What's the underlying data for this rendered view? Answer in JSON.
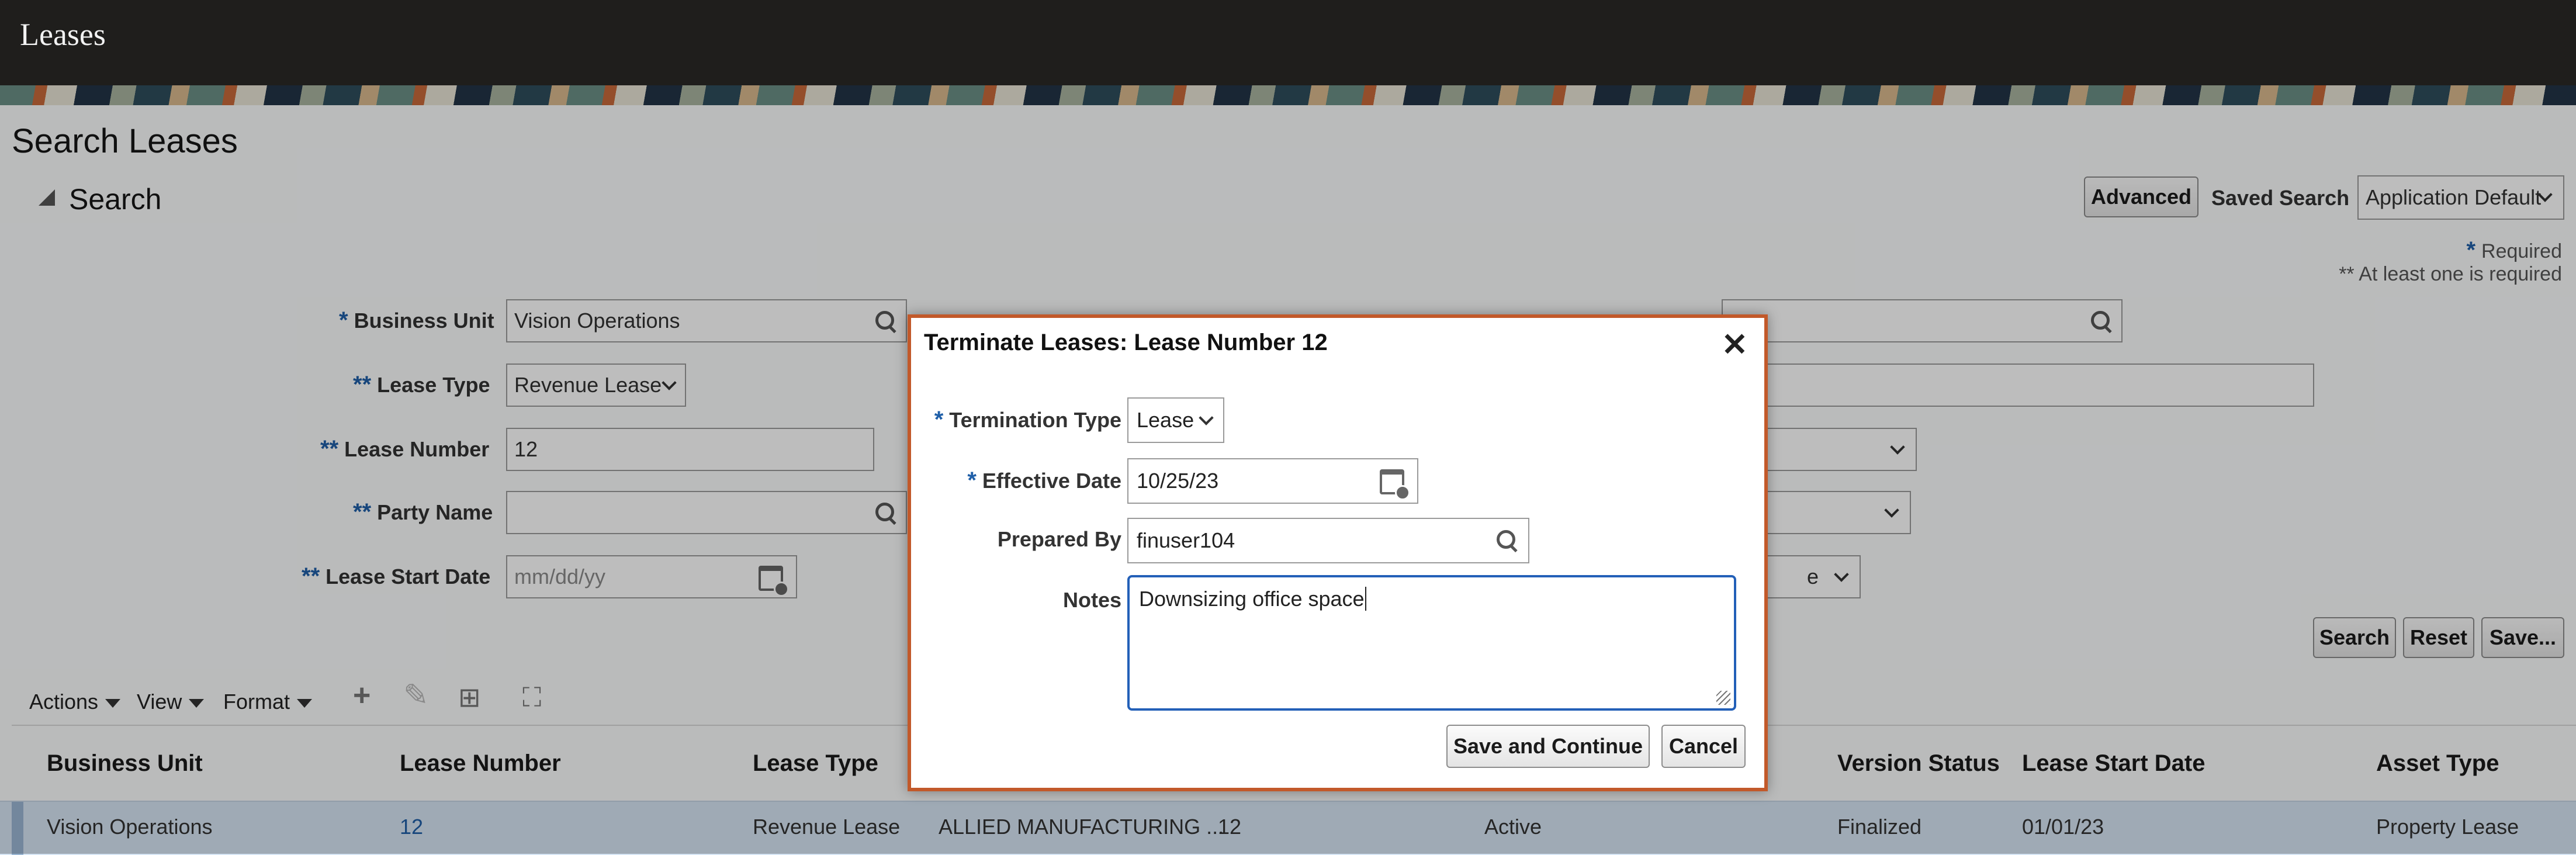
{
  "app": {
    "title": "Leases"
  },
  "page": {
    "title": "Search Leases"
  },
  "search": {
    "header": "Search",
    "advanced_label": "Advanced",
    "saved_search_label": "Saved Search",
    "saved_search_value": "Application Default",
    "required_note": "Required",
    "required_star": "*",
    "at_least_one_note": "** At least one is required",
    "fields": {
      "business_unit": {
        "label": "Business Unit",
        "marker": "*",
        "value": "Vision Operations"
      },
      "lease_type": {
        "label": "Lease Type",
        "marker": "**",
        "value": "Revenue Lease"
      },
      "lease_number": {
        "label": "Lease Number",
        "marker": "**",
        "value": "12"
      },
      "party_name": {
        "label": "Party Name",
        "marker": "**",
        "value": ""
      },
      "lease_start_date": {
        "label": "Lease Start Date",
        "marker": "**",
        "placeholder": "mm/dd/yy"
      }
    },
    "right_fields": {
      "partial_select_text": "e"
    },
    "buttons": {
      "search": "Search",
      "reset": "Reset",
      "save": "Save..."
    }
  },
  "toolbar": {
    "actions": "Actions",
    "view": "View",
    "format": "Format"
  },
  "table": {
    "columns": [
      "Business Unit",
      "Lease Number",
      "Lease Type",
      "Version Status",
      "Lease Start Date",
      "Asset Type"
    ],
    "rows": [
      {
        "business_unit": "Vision Operations",
        "lease_number": "12",
        "lease_type": "Revenue Lease",
        "party": "ALLIED MANUFACTURING ...",
        "number2": "12",
        "status": "Active",
        "version_status": "Finalized",
        "lease_start_date": "01/01/23",
        "asset_type": "Property Lease"
      }
    ]
  },
  "dialog": {
    "title": "Terminate Leases: Lease Number 12",
    "termination_type": {
      "label": "Termination Type",
      "marker": "*",
      "value": "Lease"
    },
    "effective_date": {
      "label": "Effective Date",
      "marker": "*",
      "value": "10/25/23"
    },
    "prepared_by": {
      "label": "Prepared By",
      "value": "finuser104"
    },
    "notes": {
      "label": "Notes",
      "value": "Downsizing office space"
    },
    "save_continue": "Save and Continue",
    "cancel": "Cancel"
  },
  "colors": {
    "titlebar": "#1f1e1c",
    "accent": "#1f5fa8",
    "dialog_border": "#c2592a",
    "focus": "#2360b8"
  },
  "icons": [
    "search-icon",
    "calendar-icon",
    "close-icon",
    "chevron-down-icon",
    "add-icon",
    "edit-icon",
    "freeze-icon",
    "detach-icon"
  ]
}
